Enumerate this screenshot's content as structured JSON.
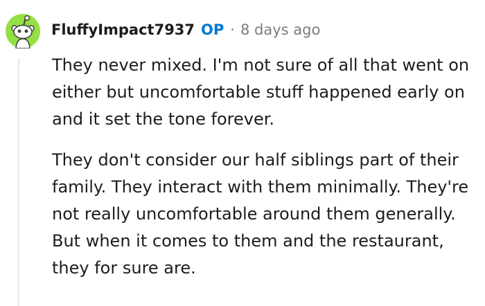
{
  "comment": {
    "author": "FluffyImpact7937",
    "op_badge": "OP",
    "separator": "·",
    "timestamp": "8 days ago",
    "avatar_icon": "reddit-snoo-icon",
    "paragraphs": [
      "They never mixed. I'm not sure of all that went on either but uncomfortable stuff happened early on and it set the tone forever.",
      "They don't consider our half siblings part of their family. They interact with them minimally. They're not really uncomfortable around them generally. But when it comes to them and the restaurant, they for sure are."
    ]
  },
  "colors": {
    "op_accent": "#0079d3",
    "avatar_bg": "#94e044",
    "text": "#1c1c1c",
    "meta": "#7c7c7c"
  }
}
